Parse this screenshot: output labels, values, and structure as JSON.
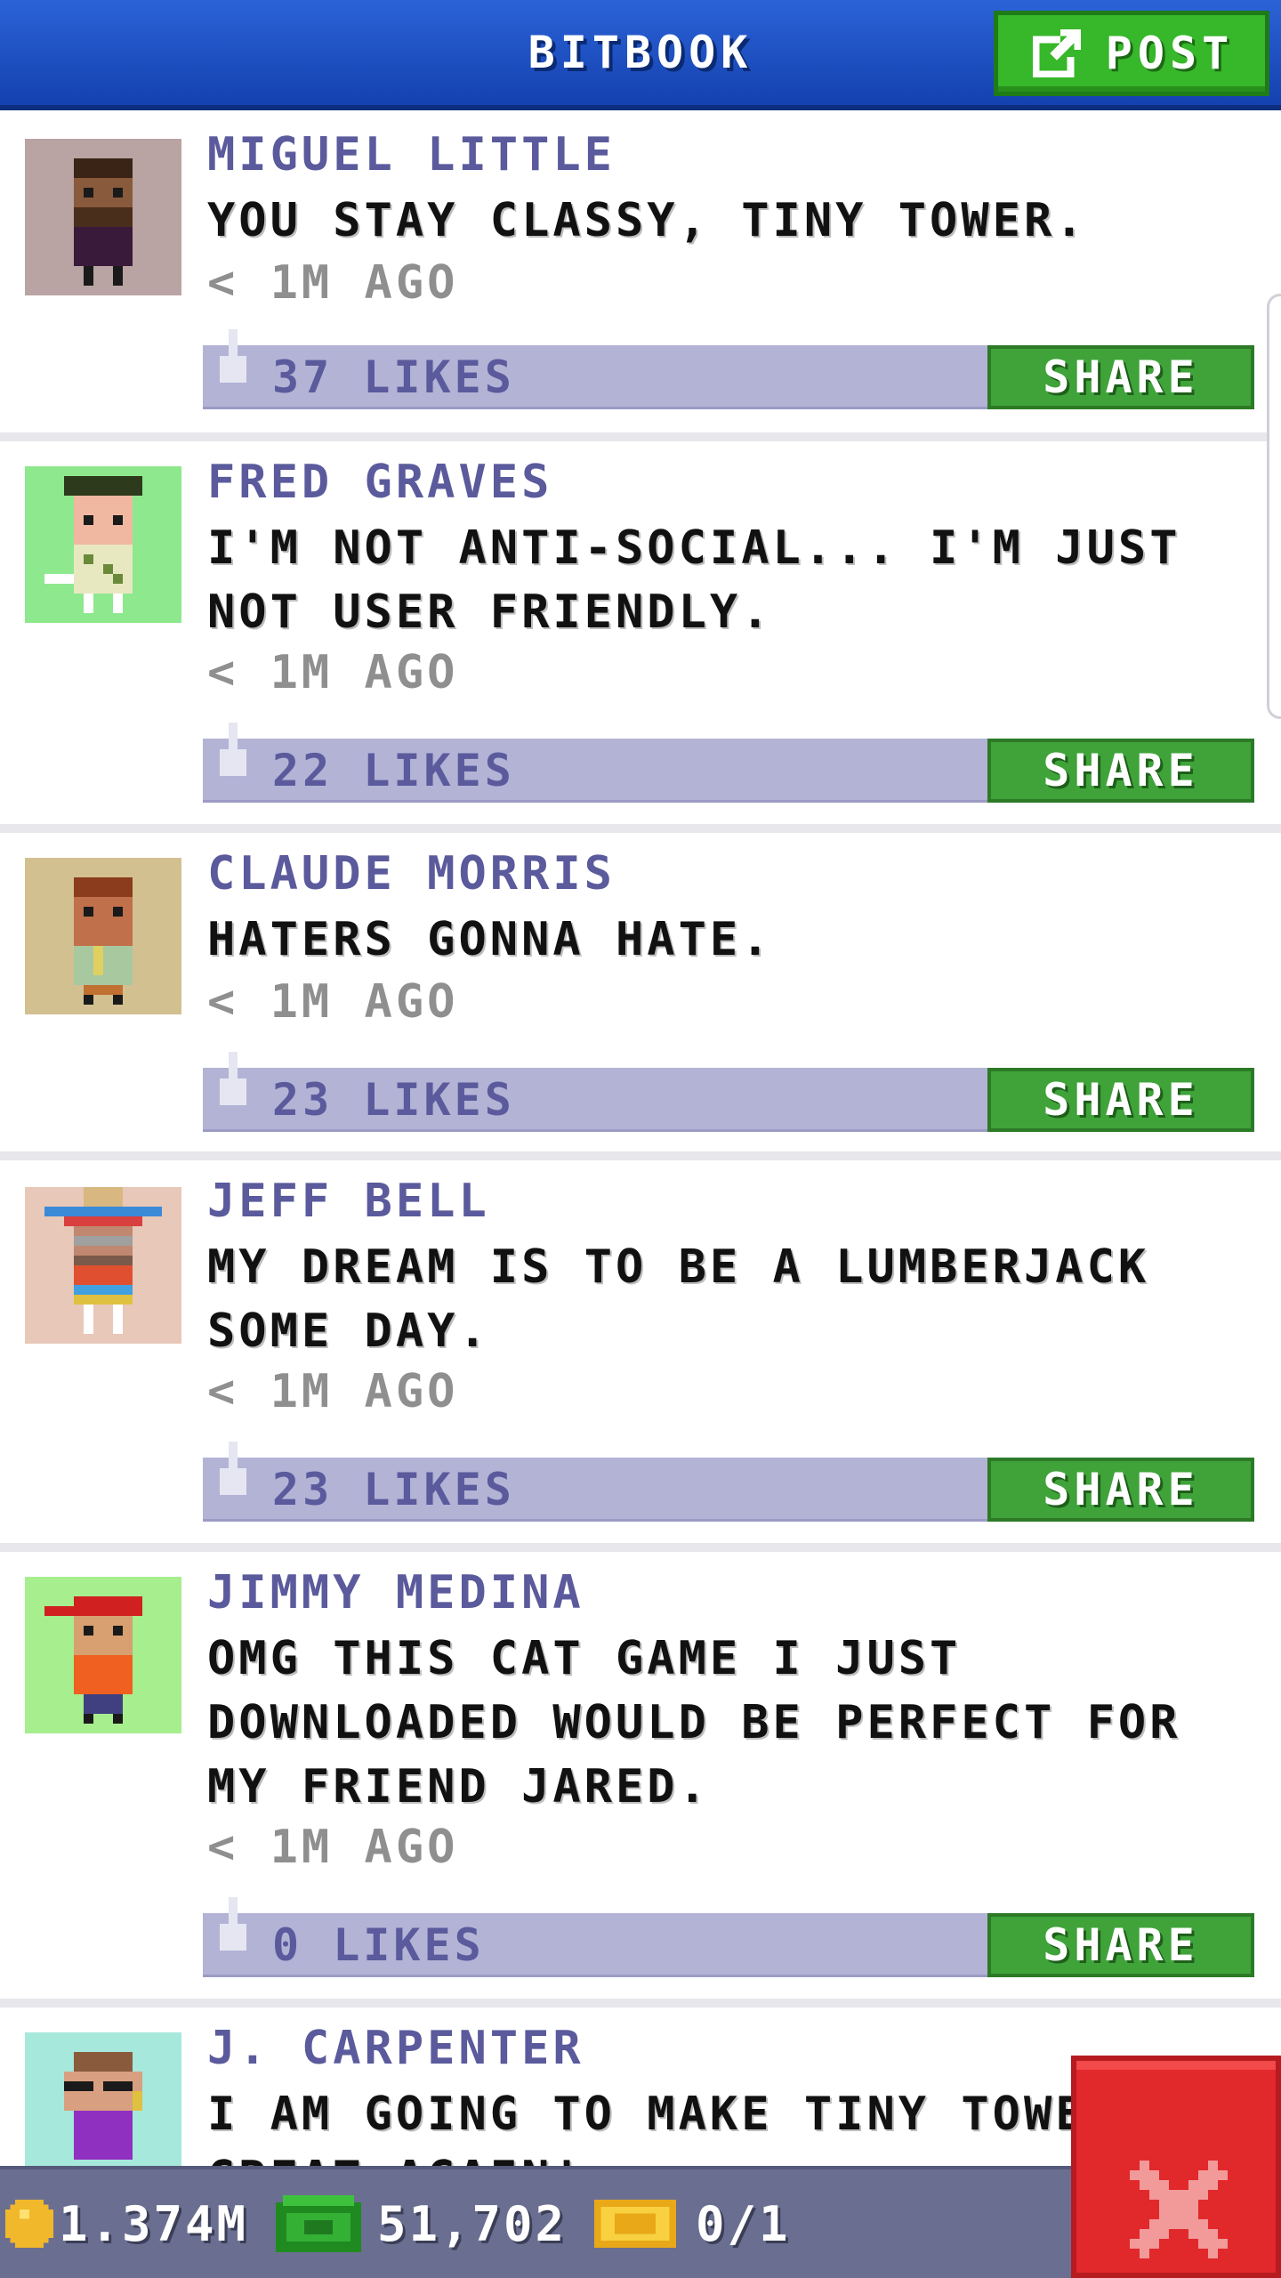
{
  "header": {
    "title": "BITBOOK",
    "post_label": "POST"
  },
  "colors": {
    "header_blue": "#1f52c4",
    "post_green": "#37b72a",
    "share_green": "#3fa33a",
    "likes_bar": "#b3b3d6",
    "name_purple": "#5a5a9c",
    "close_red": "#e1282b"
  },
  "posts": [
    {
      "name": "MIGUEL LITTLE",
      "text": "YOU STAY CLASSY, TINY TOWER.",
      "time": "< 1M AGO",
      "likes": "37 LIKES",
      "share": "SHARE",
      "avatar_bg": "#b9a3a3"
    },
    {
      "name": "FRED GRAVES",
      "text": "I'M NOT ANTI-SOCIAL... I'M JUST NOT USER FRIENDLY.",
      "time": "< 1M AGO",
      "likes": "22 LIKES",
      "share": "SHARE",
      "avatar_bg": "#8ee88e"
    },
    {
      "name": "CLAUDE MORRIS",
      "text": "HATERS GONNA HATE.",
      "time": "< 1M AGO",
      "likes": "23 LIKES",
      "share": "SHARE",
      "avatar_bg": "#d3c091"
    },
    {
      "name": "JEFF BELL",
      "text": "MY DREAM IS TO BE A LUMBERJACK SOME DAY.",
      "time": "< 1M AGO",
      "likes": "23 LIKES",
      "share": "SHARE",
      "avatar_bg": "#e8c8b8"
    },
    {
      "name": "JIMMY MEDINA",
      "text": "OMG THIS CAT GAME I JUST DOWNLOADED WOULD BE PERFECT FOR MY FRIEND JARED.",
      "time": "< 1M AGO",
      "likes": "0 LIKES",
      "share": "SHARE",
      "avatar_bg": "#a6ee8e"
    },
    {
      "name": "J. CARPENTER",
      "text": "I AM GOING TO MAKE TINY TOWER GREAT AGAIN!",
      "avatar_bg": "#a6e8dc"
    }
  ],
  "status": {
    "coins": "1.374M",
    "bux": "51,702",
    "tickets": "0/1"
  }
}
